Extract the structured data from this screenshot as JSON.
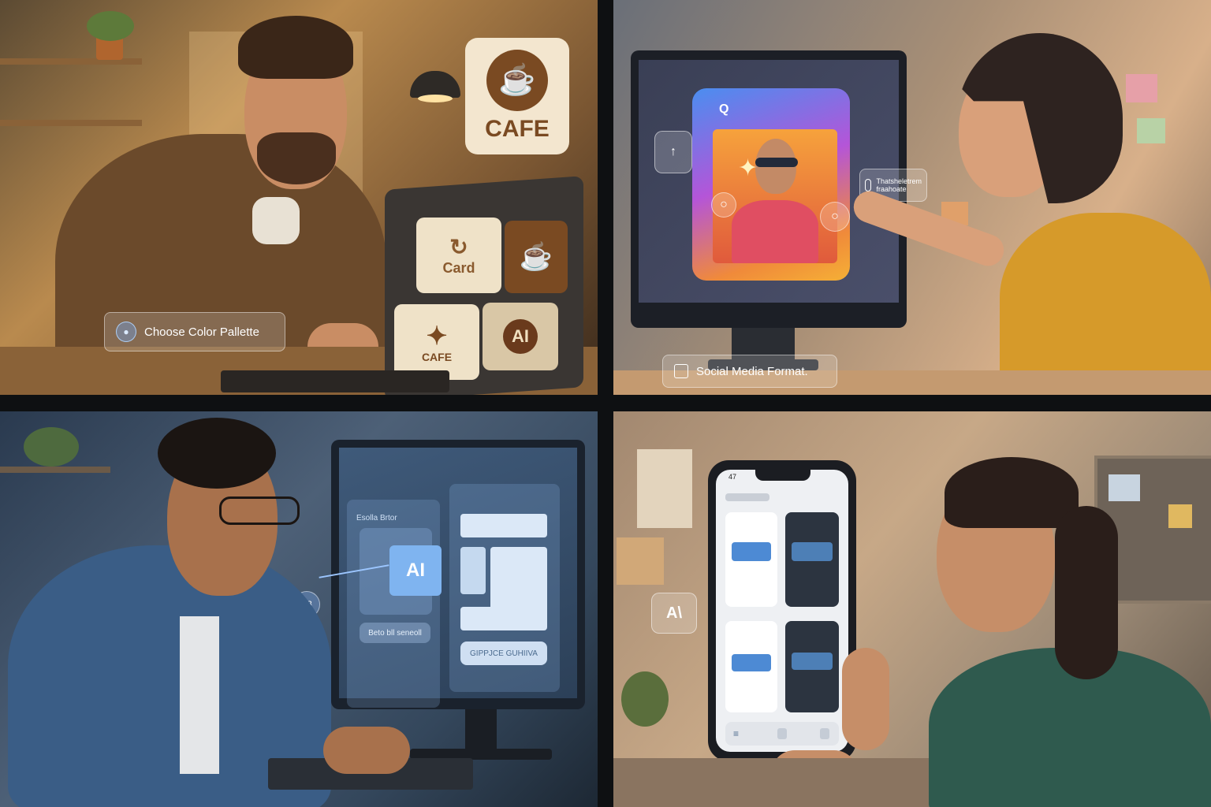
{
  "panel1": {
    "cafe_logo_text": "CAFE",
    "tiles": [
      {
        "label": "Card"
      },
      {
        "label": ""
      },
      {
        "label": "CAFE"
      },
      {
        "label": "AI"
      }
    ],
    "chip_label": "Choose Color Pallette"
  },
  "panel2": {
    "app_badge": "Q",
    "side_label": "Thatsheletrem fraahoate",
    "chip_label": "Social Media Format."
  },
  "panel3": {
    "ai_tile": "AI",
    "float_badge": "A3",
    "panel_header": "Esolla Brtor",
    "left_button": "Beto bll seneoll",
    "right_button": "GIPPJCE GUHIIVA"
  },
  "panel4": {
    "ai_badge": "A\\",
    "phone_time": "47"
  },
  "colors": {
    "chip_glow": "#6aa8ff",
    "cafe_brown": "#7a4a22",
    "card_cream": "#efe2c8"
  }
}
